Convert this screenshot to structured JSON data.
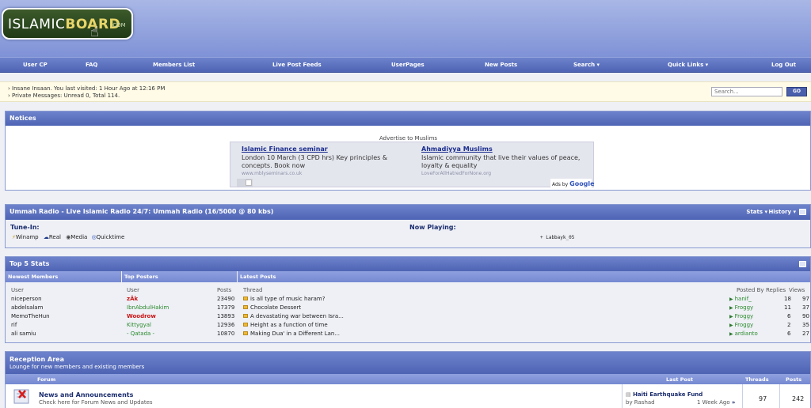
{
  "logo": {
    "part1": "ISLAMIC",
    "part2": "BOARD",
    "suffix": ".COM"
  },
  "nav": [
    "User CP",
    "FAQ",
    "Members List",
    "Live Post Feeds",
    "UserPages",
    "New Posts",
    "Search ▾",
    "Quick Links ▾",
    "Log Out"
  ],
  "welcome": {
    "line1": "› Insane Insaan. You last visited: 1 Hour Ago at 12:16 PM",
    "line2": "› Private Messages: Unread 0, Total 114."
  },
  "search": {
    "placeholder": "Search...",
    "value": "Search...",
    "go": "GO"
  },
  "notices": {
    "title": "Notices",
    "advertise": "Advertise to Muslims",
    "ad1_title": "Islamic Finance seminar",
    "ad1_text1": "London 10 March (3 CPD hrs) Key principles &",
    "ad1_text2": "concepts. Book now",
    "ad1_url": "www.mblyseminars.co.uk",
    "ad2_title": "Ahmadiyya Muslims",
    "ad2_text1": "Islamic community that live their values of peace,",
    "ad2_text2": "loyalty & equality",
    "ad2_url": "LoveForAllHatredForNone.org",
    "ads_by": "Ads by",
    "google": "Google"
  },
  "radio": {
    "title": "Ummah Radio - Live Islamic Radio 24/7: Ummah Radio (16/5000 @ 80 kbs)",
    "stats": "Stats ▾",
    "history": "History ▾",
    "tune_in": "Tune-In:",
    "now_playing_label": "Now Playing:",
    "now_playing": "+ Labbayk_05",
    "players": [
      "Winamp",
      "Real",
      "Media",
      "Quicktime"
    ]
  },
  "stats": {
    "title": "Top 5 Stats",
    "newest_header": "Newest Members",
    "posters_header": "Top Posters",
    "latest_header": "Latest Posts",
    "col_user": "User",
    "col_user2": "User",
    "col_posts": "Posts",
    "col_thread": "Thread",
    "col_posted_by": "Posted By",
    "col_replies": "Replies",
    "col_views": "Views",
    "newest": [
      "niceperson",
      "abdelsalam",
      "MemoTheHun",
      "rif",
      "ali samiu"
    ],
    "posters": [
      {
        "name": "zÂk",
        "posts": "23490"
      },
      {
        "name": "IbnAbdulHakim",
        "posts": "17379"
      },
      {
        "name": "Woodrow",
        "posts": "13893"
      },
      {
        "name": "Kittygyal",
        "posts": "12936"
      },
      {
        "name": "- Qatada -",
        "posts": "10870"
      }
    ],
    "threads": [
      {
        "title": "is all type of music haram?",
        "by": "hanif_",
        "replies": "18",
        "views": "97"
      },
      {
        "title": "Chocolate Dessert",
        "by": "Froggy",
        "replies": "11",
        "views": "37"
      },
      {
        "title": "A devastating war between Isra...",
        "by": "Froggy",
        "replies": "6",
        "views": "90"
      },
      {
        "title": "Height as a function of time",
        "by": "Froggy",
        "replies": "2",
        "views": "35"
      },
      {
        "title": "Making Dua' in a Different Lan...",
        "by": "ardianto",
        "replies": "6",
        "views": "27"
      }
    ]
  },
  "reception": {
    "title": "Reception Area",
    "subtitle": "Lounge for new members and existing members",
    "col_forum": "Forum",
    "col_last": "Last Post",
    "col_threads": "Threads",
    "col_posts": "Posts",
    "forum_name": "News and Announcements",
    "forum_desc": "Check here for Forum News and Updates",
    "last_title": "Haiti Earthquake Fund",
    "last_by": "by Rashad",
    "last_time": "1 Week Ago",
    "threads": "97",
    "posts": "242"
  },
  "colors": {
    "nav": "#5a6fbf",
    "header": "#9aabe2",
    "accent_red": "#cc1111",
    "accent_green": "#2d8a2d"
  }
}
